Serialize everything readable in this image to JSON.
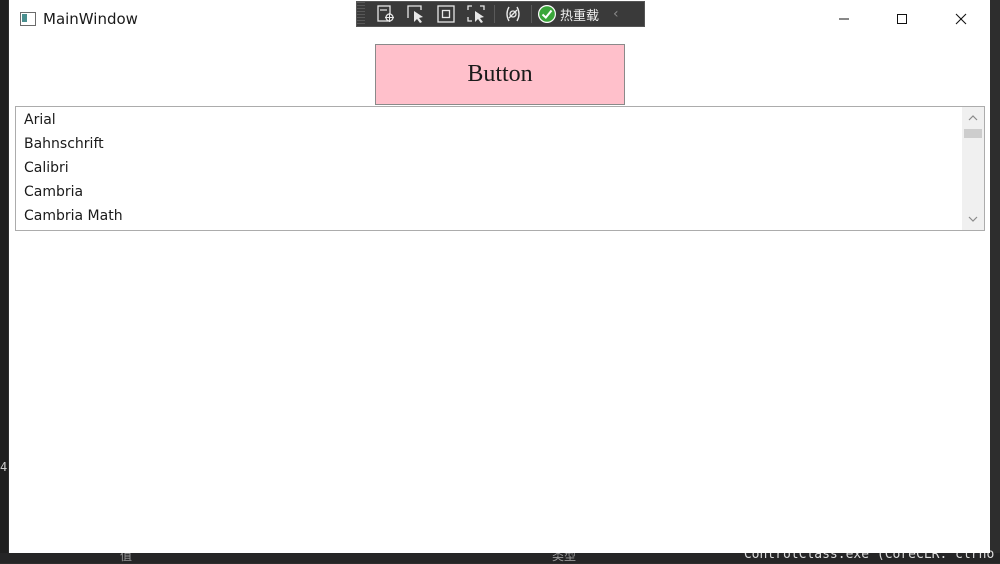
{
  "window": {
    "title": "MainWindow",
    "button_label": "Button",
    "button_color": "#ffc0cb"
  },
  "debug_toolbar": {
    "hot_reload_label": "热重载",
    "icons": [
      "live-visual-tree-icon",
      "select-element-icon",
      "display-layout-adorners-icon",
      "track-focused-element-icon",
      "binding-failures-icon",
      "hot-reload-check-icon",
      "collapse-arrow-icon"
    ]
  },
  "listbox": {
    "items": [
      "Arial",
      "Bahnschrift",
      "Calibri",
      "Cambria",
      "Cambria Math"
    ]
  },
  "background": {
    "output_text": "“ControlClass.exe”(CoreCLR: clrho",
    "edge_text": "4",
    "label_left": "值",
    "label_mid": "类型"
  }
}
